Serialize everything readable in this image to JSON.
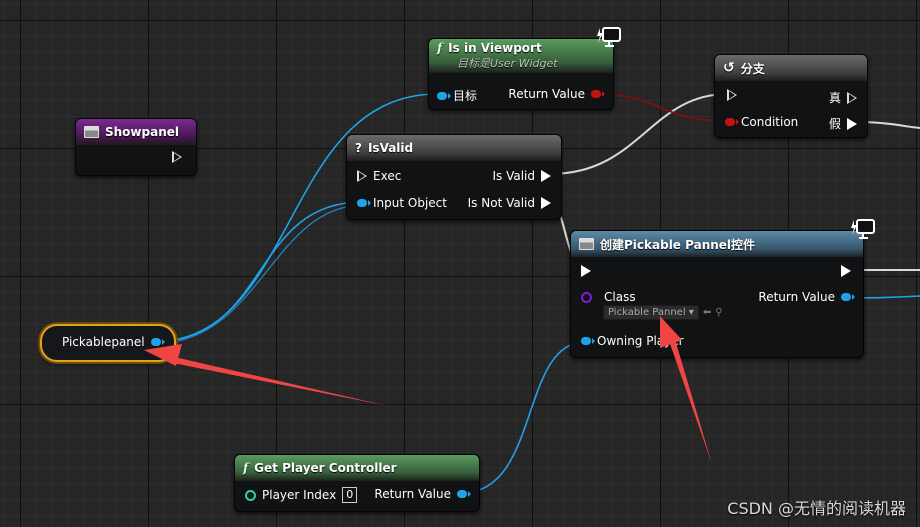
{
  "nodes": {
    "showpanel": {
      "title": "Showpanel",
      "color": "#7b2b92"
    },
    "is_in_viewport": {
      "title": "Is in Viewport",
      "subtitle": "目标是User Widget",
      "pins": {
        "target": "目标",
        "return_value": "Return Value"
      }
    },
    "branch": {
      "title": "分支",
      "pins": {
        "condition": "Condition",
        "true": "真",
        "false": "假"
      }
    },
    "is_valid": {
      "title": "IsValid",
      "pins": {
        "exec": "Exec",
        "input_object": "Input Object",
        "is_valid": "Is Valid",
        "is_not_valid": "Is Not Valid"
      }
    },
    "create_widget": {
      "title": "创建Pickable Pannel控件",
      "pins": {
        "class": "Class",
        "class_value": "Pickable Pannel",
        "owning_player": "Owning Player",
        "return_value": "Return Value"
      }
    },
    "pickablepanel_var": {
      "label": "Pickablepanel"
    },
    "get_player_controller": {
      "title": "Get Player Controller",
      "pins": {
        "player_index": "Player Index",
        "player_index_value": "0",
        "return_value": "Return Value"
      }
    }
  },
  "colors": {
    "object_pin": "#1fa3e8",
    "bool_pin": "#c31212",
    "class_pin": "#7a1fd8",
    "int_pin": "#26d4a8",
    "annotation_arrow": "#f04545",
    "variable_highlight": "#e3a21a"
  },
  "icons": {
    "function": "f-function-icon",
    "macro": "question-icon",
    "event": "box-icon",
    "branch": "branch-icon",
    "network_monitor": "monitor-lightning-icon"
  },
  "watermark": "CSDN @无情的阅读机器"
}
